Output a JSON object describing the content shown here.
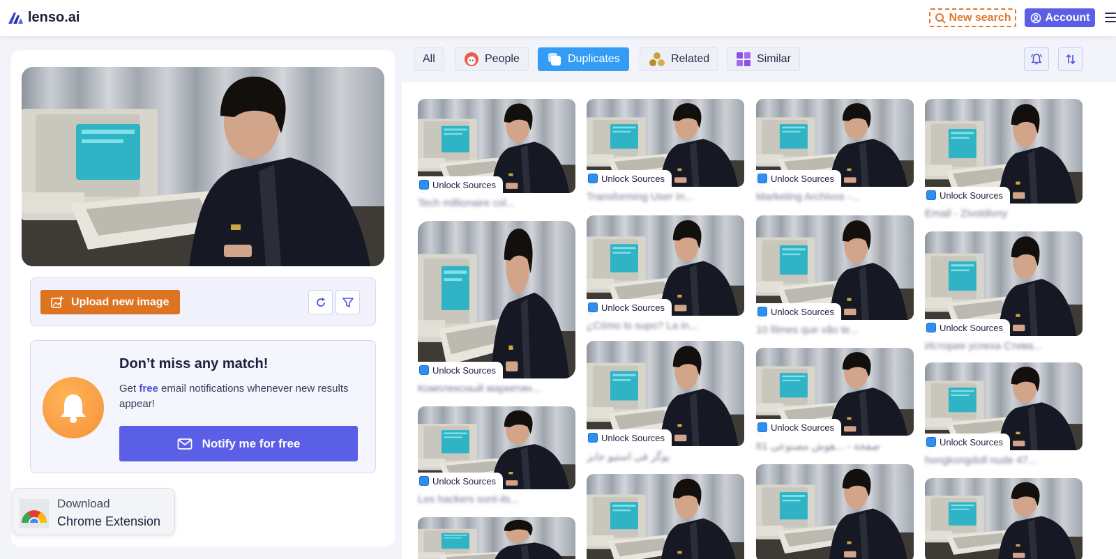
{
  "header": {
    "logo_text": "lenso.ai",
    "new_search_label": "New search",
    "account_label": "Account"
  },
  "left_panel": {
    "upload_label": "Upload new image",
    "notify": {
      "title": "Don’t miss any match!",
      "text_before": "Get ",
      "text_free": "free",
      "text_after": " email notifications whenever new results appear!",
      "button_label": "Notify me for free"
    },
    "chrome_extension": {
      "line1": "Download",
      "line2": "Chrome Extension"
    }
  },
  "filters": {
    "all": "All",
    "people": "People",
    "duplicates": "Duplicates",
    "related": "Related",
    "similar": "Similar",
    "active": "Duplicates"
  },
  "results": {
    "badge_label": "Unlock Sources",
    "items": [
      {
        "caption": "Tech millionaire col..."
      },
      {
        "caption": "Комплексный маркетин..."
      },
      {
        "caption": "Les hackers sont-ils..."
      },
      {
        "caption": "Transforming User In..."
      },
      {
        "caption": "¿Cómo lo supo? La in..."
      },
      {
        "caption": "یوگر فی استیو جابز"
      },
      {
        "caption": "Marketing Archivos -..."
      },
      {
        "caption": "10 filmes que vão te..."
      },
      {
        "caption": "61 صفحة - ...هوش مصنوعی"
      },
      {
        "caption": "Email - Zivotdivny"
      },
      {
        "caption": "История успеха Стива..."
      },
      {
        "caption": "hongkongdoll nude 47..."
      }
    ]
  },
  "colors": {
    "accent": "#5b5fe6",
    "orange": "#dc7422",
    "active_chip": "#349cf5"
  }
}
